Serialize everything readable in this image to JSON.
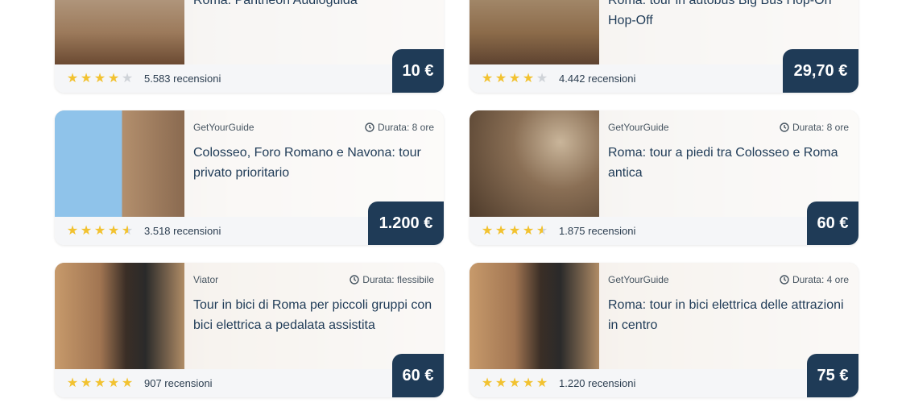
{
  "cards": [
    {
      "provider": "",
      "duration": "",
      "title": "Roma: Pantheon Audioguida",
      "rating": 4,
      "reviews": "5.583 recensioni",
      "price": "10 €"
    },
    {
      "provider": "",
      "duration": "",
      "title": "Roma: tour in autobus Big Bus Hop-On Hop-Off",
      "rating": 4,
      "reviews": "4.442 recensioni",
      "price": "29,70 €"
    },
    {
      "provider": "GetYourGuide",
      "duration": "Durata: 8 ore",
      "title": "Colosseo, Foro Romano e Navona: tour privato prioritario",
      "rating": 4.5,
      "reviews": "3.518 recensioni",
      "price": "1.200 €"
    },
    {
      "provider": "GetYourGuide",
      "duration": "Durata: 8 ore",
      "title": "Roma: tour a piedi tra Colosseo e Roma antica",
      "rating": 4.5,
      "reviews": "1.875 recensioni",
      "price": "60 €"
    },
    {
      "provider": "Viator",
      "duration": "Durata: flessibile",
      "title": "Tour in bici di Roma per piccoli gruppi con bici elettrica a pedalata assistita",
      "rating": 5,
      "reviews": "907 recensioni",
      "price": "60 €"
    },
    {
      "provider": "GetYourGuide",
      "duration": "Durata: 4 ore",
      "title": "Roma: tour in bici elettrica delle attrazioni in centro",
      "rating": 5,
      "reviews": "1.220 recensioni",
      "price": "75 €"
    }
  ],
  "colors": {
    "price_bg": "#1f3b57",
    "title": "#1f3b57",
    "star": "#f2c230",
    "star_empty": "#cfd3d8"
  },
  "icons": {
    "clock": "clock-icon",
    "star": "star-icon"
  }
}
